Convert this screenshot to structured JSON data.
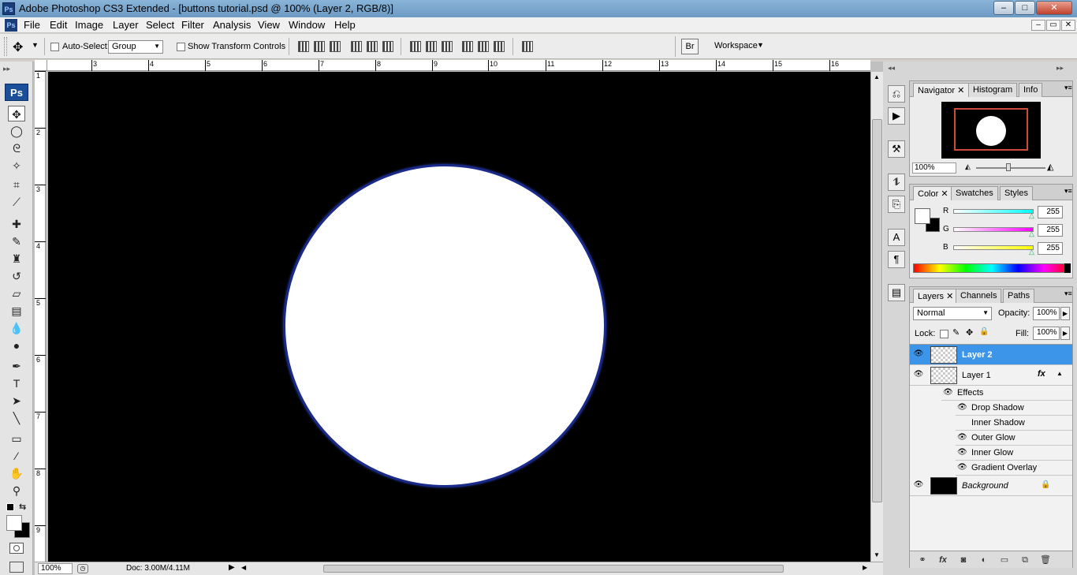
{
  "window": {
    "title": "Adobe Photoshop CS3 Extended - [buttons tutorial.psd @ 100% (Layer 2, RGB/8)]",
    "app_logo": "Ps",
    "controls": {
      "minimize": "–",
      "maximize": "□",
      "close": "✕"
    }
  },
  "menu": {
    "items": [
      "File",
      "Edit",
      "Image",
      "Layer",
      "Select",
      "Filter",
      "Analysis",
      "View",
      "Window",
      "Help"
    ],
    "doc_controls": {
      "minimize": "–",
      "restore": "▭",
      "close": "✕"
    }
  },
  "options": {
    "auto_select_label": "Auto-Select:",
    "auto_select_value": "Group",
    "show_transform_label": "Show Transform Controls",
    "workspace_label": "Workspace"
  },
  "toolbox": {
    "logo": "Ps",
    "tools": [
      {
        "name": "move-tool-icon",
        "glyph": "✥"
      },
      {
        "name": "elliptical-marquee-icon",
        "glyph": "◯"
      },
      {
        "name": "lasso-icon",
        "glyph": "ᘓ"
      },
      {
        "name": "magic-wand-icon",
        "glyph": "✧"
      },
      {
        "name": "crop-icon",
        "glyph": "⌗"
      },
      {
        "name": "slice-icon",
        "glyph": "⟋"
      },
      {
        "name": "healing-brush-icon",
        "glyph": "✚"
      },
      {
        "name": "brush-icon",
        "glyph": "✎"
      },
      {
        "name": "clone-stamp-icon",
        "glyph": "♜"
      },
      {
        "name": "history-brush-icon",
        "glyph": "↺"
      },
      {
        "name": "eraser-icon",
        "glyph": "▱"
      },
      {
        "name": "gradient-icon",
        "glyph": "▤"
      },
      {
        "name": "blur-icon",
        "glyph": "💧"
      },
      {
        "name": "dodge-icon",
        "glyph": "●"
      },
      {
        "name": "pen-icon",
        "glyph": "✒"
      },
      {
        "name": "type-icon",
        "glyph": "T"
      },
      {
        "name": "path-selection-icon",
        "glyph": "➤"
      },
      {
        "name": "line-icon",
        "glyph": "╲"
      },
      {
        "name": "notes-icon",
        "glyph": "▭"
      },
      {
        "name": "eyedropper-icon",
        "glyph": "⁄"
      },
      {
        "name": "hand-icon",
        "glyph": "✋"
      },
      {
        "name": "zoom-icon",
        "glyph": "⚲"
      }
    ]
  },
  "rulers": {
    "horizontal": [
      "3",
      "4",
      "5",
      "6",
      "7",
      "8",
      "9",
      "10",
      "11",
      "12",
      "13",
      "14",
      "15",
      "16"
    ],
    "vertical": [
      "1",
      "2",
      "3",
      "4",
      "5",
      "6",
      "7",
      "8",
      "9"
    ]
  },
  "status": {
    "zoom": "100%",
    "doc": "Doc: 3.00M/4.11M"
  },
  "navigator": {
    "tabs": [
      "Navigator",
      "Histogram",
      "Info"
    ],
    "zoom": "100%"
  },
  "color": {
    "tabs": [
      "Color",
      "Swatches",
      "Styles"
    ],
    "channels": [
      {
        "label": "R",
        "value": "255",
        "gradient": "#00ffff"
      },
      {
        "label": "G",
        "value": "255",
        "gradient": "#ff00ff"
      },
      {
        "label": "B",
        "value": "255",
        "gradient": "#ffff00"
      }
    ]
  },
  "layers": {
    "tabs": [
      "Layers",
      "Channels",
      "Paths"
    ],
    "blend_mode": "Normal",
    "opacity_label": "Opacity:",
    "opacity": "100%",
    "lock_label": "Lock:",
    "fill_label": "Fill:",
    "fill": "100%",
    "fx_symbol": "fx",
    "list": [
      {
        "name": "Layer 2",
        "selected": true
      },
      {
        "name": "Layer 1",
        "selected": false
      }
    ],
    "effects_label": "Effects",
    "effects": [
      {
        "name": "Drop Shadow",
        "visible": true
      },
      {
        "name": "Inner Shadow",
        "visible": false
      },
      {
        "name": "Outer Glow",
        "visible": true
      },
      {
        "name": "Inner Glow",
        "visible": true
      },
      {
        "name": "Gradient Overlay",
        "visible": true
      }
    ],
    "background_name": "Background"
  },
  "colors": {
    "selection_blue": "#3d95ea",
    "canvas_bg": "#000000"
  }
}
